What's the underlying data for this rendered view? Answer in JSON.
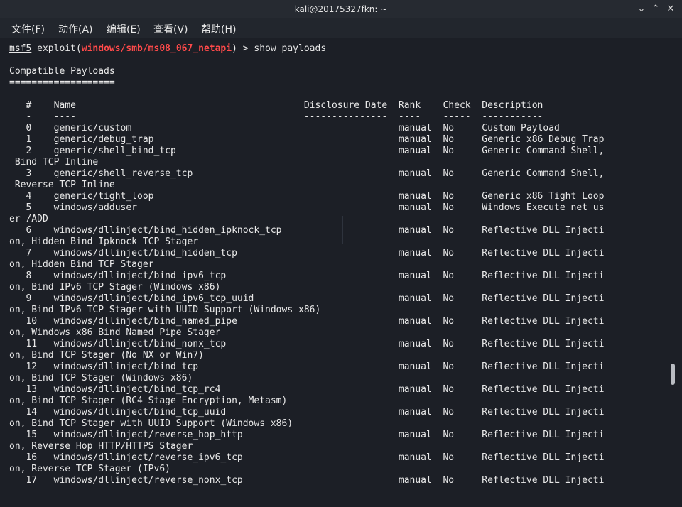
{
  "window": {
    "title": "kali@20175327fkn: ~",
    "minimize_icon": "minimize-icon",
    "maximize_icon": "maximize-icon",
    "close_icon": "close-icon"
  },
  "menu": [
    {
      "label": "文件(F)"
    },
    {
      "label": "动作(A)"
    },
    {
      "label": "编辑(E)"
    },
    {
      "label": "查看(V)"
    },
    {
      "label": "帮助(H)"
    }
  ],
  "prompt": {
    "prefix": "msf5",
    "mid": " exploit(",
    "module": "windows/smb/ms08_067_netapi",
    "suffix": ") > show payloads"
  },
  "section": {
    "title": "Compatible Payloads",
    "underline": "==================="
  },
  "table": {
    "header": "   #    Name                                         Disclosure Date  Rank    Check  Description",
    "divider": "   -    ----                                         ---------------  ----    -----  -----------",
    "lines": [
      "   0    generic/custom                                                manual  No     Custom Payload",
      "   1    generic/debug_trap                                            manual  No     Generic x86 Debug Trap",
      "   2    generic/shell_bind_tcp                                        manual  No     Generic Command Shell,",
      " Bind TCP Inline",
      "   3    generic/shell_reverse_tcp                                     manual  No     Generic Command Shell,",
      " Reverse TCP Inline",
      "   4    generic/tight_loop                                            manual  No     Generic x86 Tight Loop",
      "   5    windows/adduser                                               manual  No     Windows Execute net us",
      "er /ADD",
      "   6    windows/dllinject/bind_hidden_ipknock_tcp                     manual  No     Reflective DLL Injecti",
      "on, Hidden Bind Ipknock TCP Stager",
      "   7    windows/dllinject/bind_hidden_tcp                             manual  No     Reflective DLL Injecti",
      "on, Hidden Bind TCP Stager",
      "   8    windows/dllinject/bind_ipv6_tcp                               manual  No     Reflective DLL Injecti",
      "on, Bind IPv6 TCP Stager (Windows x86)",
      "   9    windows/dllinject/bind_ipv6_tcp_uuid                          manual  No     Reflective DLL Injecti",
      "on, Bind IPv6 TCP Stager with UUID Support (Windows x86)",
      "   10   windows/dllinject/bind_named_pipe                             manual  No     Reflective DLL Injecti",
      "on, Windows x86 Bind Named Pipe Stager",
      "   11   windows/dllinject/bind_nonx_tcp                               manual  No     Reflective DLL Injecti",
      "on, Bind TCP Stager (No NX or Win7)",
      "   12   windows/dllinject/bind_tcp                                    manual  No     Reflective DLL Injecti",
      "on, Bind TCP Stager (Windows x86)",
      "   13   windows/dllinject/bind_tcp_rc4                                manual  No     Reflective DLL Injecti",
      "on, Bind TCP Stager (RC4 Stage Encryption, Metasm)",
      "   14   windows/dllinject/bind_tcp_uuid                               manual  No     Reflective DLL Injecti",
      "on, Bind TCP Stager with UUID Support (Windows x86)",
      "   15   windows/dllinject/reverse_hop_http                            manual  No     Reflective DLL Injecti",
      "on, Reverse Hop HTTP/HTTPS Stager",
      "   16   windows/dllinject/reverse_ipv6_tcp                            manual  No     Reflective DLL Injecti",
      "on, Reverse TCP Stager (IPv6)",
      "   17   windows/dllinject/reverse_nonx_tcp                            manual  No     Reflective DLL Injecti"
    ]
  }
}
